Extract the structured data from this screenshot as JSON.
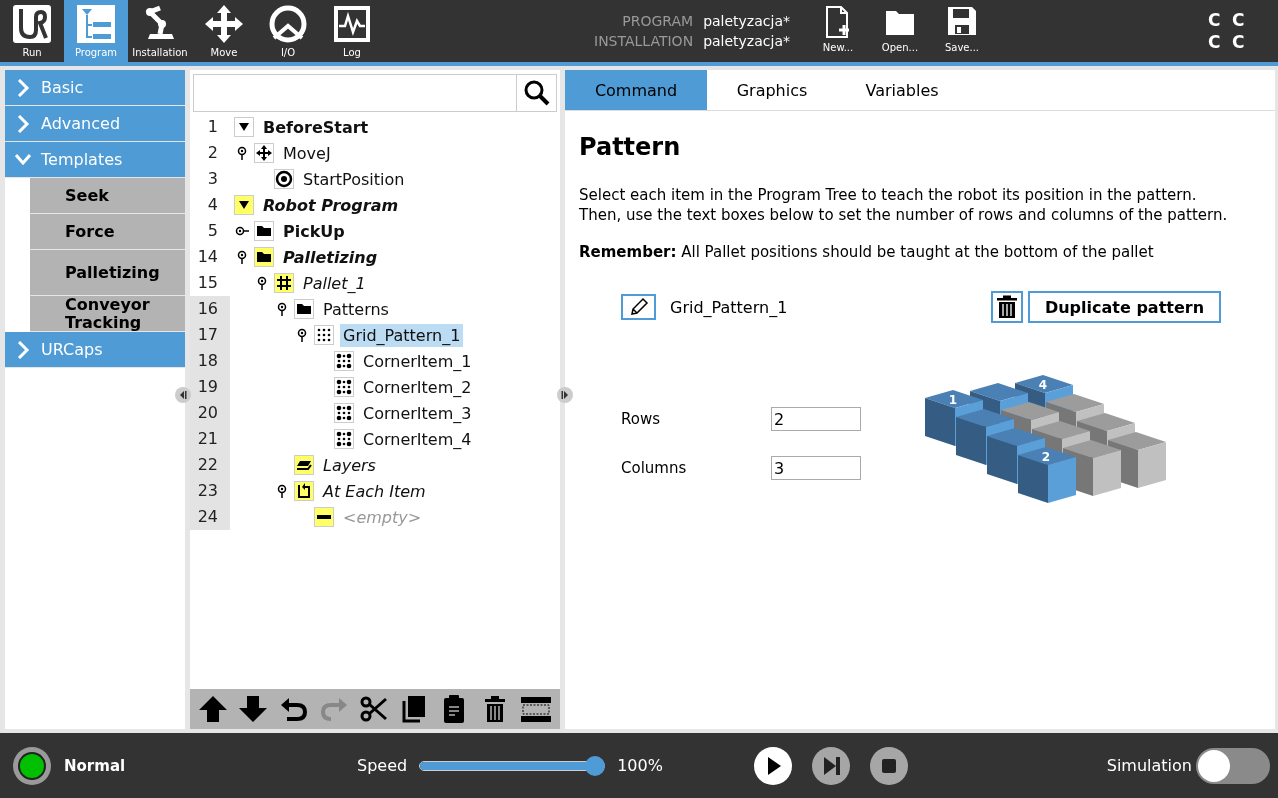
{
  "nav": [
    {
      "label": "Run",
      "selected": false
    },
    {
      "label": "Program",
      "selected": true
    },
    {
      "label": "Installation",
      "selected": false
    },
    {
      "label": "Move",
      "selected": false
    },
    {
      "label": "I/O",
      "selected": false
    },
    {
      "label": "Log",
      "selected": false
    }
  ],
  "files": [
    {
      "label": "PROGRAM",
      "value": "paletyzacja*"
    },
    {
      "label": "INSTALLATION",
      "value": "paletyzacja*"
    }
  ],
  "file_actions": [
    "New...",
    "Open...",
    "Save..."
  ],
  "indicators": [
    "C",
    "C",
    "C",
    "C"
  ],
  "sidebar": [
    {
      "label": "Basic",
      "expanded": false
    },
    {
      "label": "Advanced",
      "expanded": false
    },
    {
      "label": "Templates",
      "expanded": true,
      "children": [
        "Seek",
        "Force",
        "Palletizing",
        "Conveyor Tracking"
      ]
    },
    {
      "label": "URCaps",
      "expanded": false
    }
  ],
  "tree": [
    {
      "line": "1",
      "label": "BeforeStart",
      "kind": "section",
      "bold": true,
      "italic": false,
      "highlighted": false,
      "selected": false,
      "children": [
        {
          "line": "2",
          "label": "MoveJ",
          "kind": "move",
          "bold": false,
          "italic": false,
          "highlighted": false,
          "selected": false,
          "expanded": true,
          "children": [
            {
              "line": "3",
              "label": "StartPosition",
              "kind": "waypoint",
              "bold": false,
              "italic": false,
              "highlighted": false,
              "selected": false
            }
          ]
        }
      ]
    },
    {
      "line": "4",
      "label": "Robot Program",
      "kind": "section",
      "bold": true,
      "italic": true,
      "color": "#ffff66",
      "highlighted": false,
      "selected": false,
      "children": [
        {
          "line": "5",
          "label": "PickUp",
          "kind": "folder",
          "bold": true,
          "italic": false,
          "highlighted": false,
          "selected": false,
          "expanded": false
        },
        {
          "line": "14",
          "label": "Palletizing",
          "kind": "folder",
          "bold": true,
          "italic": true,
          "color": "#ffff66",
          "highlighted": false,
          "selected": false,
          "expanded": true,
          "children": [
            {
              "line": "15",
              "label": "Pallet_1",
              "kind": "pallet",
              "bold": false,
              "italic": true,
              "color": "#ffff66",
              "highlighted": false,
              "selected": false,
              "expanded": true,
              "children": [
                {
                  "line": "16",
                  "label": "Patterns",
                  "kind": "folder",
                  "bold": false,
                  "italic": false,
                  "highlighted": true,
                  "selected": false,
                  "expanded": true,
                  "children": [
                    {
                      "line": "17",
                      "label": "Grid_Pattern_1",
                      "kind": "pattern",
                      "bold": false,
                      "italic": false,
                      "highlighted": true,
                      "selected": true,
                      "expanded": true,
                      "children": [
                        {
                          "line": "18",
                          "label": "CornerItem_1",
                          "kind": "corner",
                          "bold": false,
                          "italic": false,
                          "highlighted": true,
                          "selected": false
                        },
                        {
                          "line": "19",
                          "label": "CornerItem_2",
                          "kind": "corner",
                          "bold": false,
                          "italic": false,
                          "highlighted": true,
                          "selected": false
                        },
                        {
                          "line": "20",
                          "label": "CornerItem_3",
                          "kind": "corner",
                          "bold": false,
                          "italic": false,
                          "highlighted": true,
                          "selected": false
                        },
                        {
                          "line": "21",
                          "label": "CornerItem_4",
                          "kind": "corner",
                          "bold": false,
                          "italic": false,
                          "highlighted": true,
                          "selected": false
                        }
                      ]
                    }
                  ]
                },
                {
                  "line": "22",
                  "label": "Layers",
                  "kind": "layers",
                  "bold": false,
                  "italic": true,
                  "color": "#ffff66",
                  "highlighted": true,
                  "selected": false
                },
                {
                  "line": "23",
                  "label": "At Each Item",
                  "kind": "action",
                  "bold": false,
                  "italic": true,
                  "color": "#ffff66",
                  "highlighted": true,
                  "selected": false,
                  "expanded": true,
                  "children": [
                    {
                      "line": "24",
                      "label": "<empty>",
                      "kind": "empty",
                      "bold": false,
                      "italic": true,
                      "color": "#ffff66",
                      "highlighted": true,
                      "selected": false
                    }
                  ]
                }
              ]
            }
          ]
        }
      ]
    }
  ],
  "tree_tools": [
    {
      "disabled": false
    },
    {
      "disabled": false
    },
    {
      "disabled": false
    },
    {
      "disabled": true
    },
    {
      "disabled": false
    },
    {
      "disabled": false
    },
    {
      "disabled": false
    },
    {
      "disabled": false
    },
    {
      "disabled": false
    }
  ],
  "tabs": [
    {
      "label": "Command",
      "selected": true
    },
    {
      "label": "Graphics",
      "selected": false
    },
    {
      "label": "Variables",
      "selected": false
    }
  ],
  "command": {
    "title": "Pattern",
    "description": [
      "Select each item in the Program Tree to teach the robot its position in the pattern.",
      "Then, use the text boxes below to set the number of rows and columns of the pattern."
    ],
    "remember": "**Remember:** All Pallet positions should be taught at the bottom of the pallet",
    "pattern_name": "Grid_Pattern_1",
    "duplicate_button": "Duplicate pattern",
    "fields": [
      {
        "label": "Rows",
        "value": "2"
      },
      {
        "label": "Columns",
        "value": "3"
      }
    ],
    "corner_labels": [
      "1",
      "4",
      "2"
    ]
  },
  "status": {
    "label": "Normal",
    "color": "#00c000"
  },
  "speed": {
    "label": "Speed",
    "level": 1.0,
    "reading": "100%"
  },
  "simulation": {
    "label": "Simulation",
    "on": false
  }
}
